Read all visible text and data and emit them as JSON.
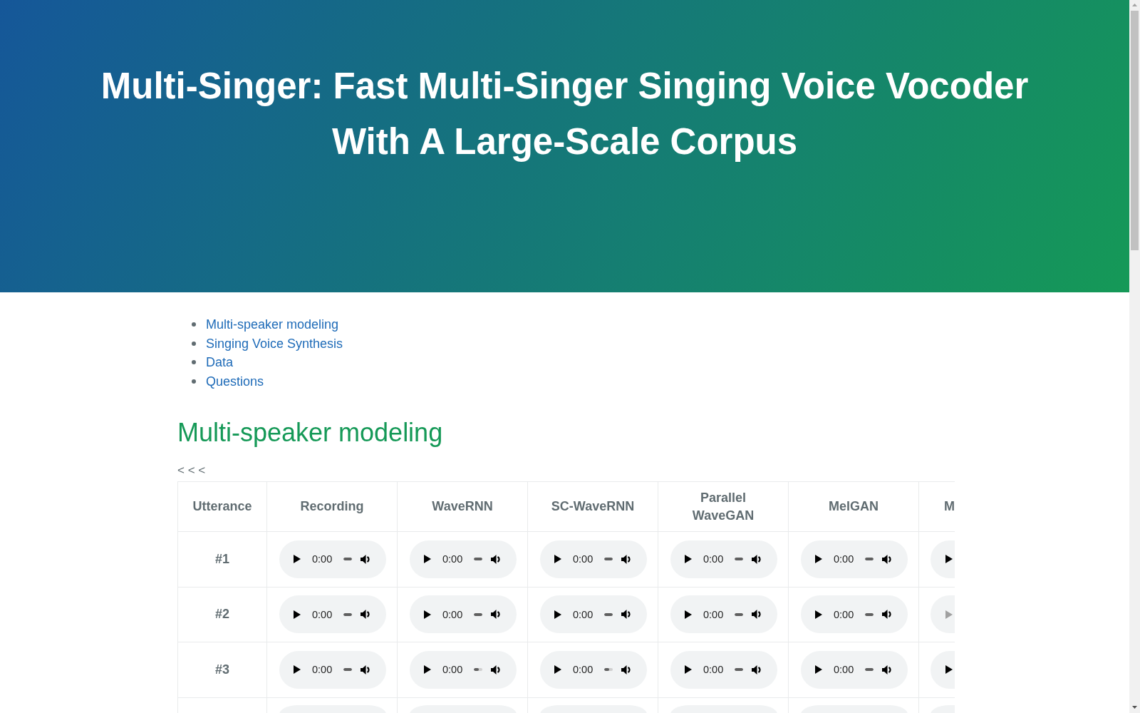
{
  "header": {
    "title": "Multi-Singer: Fast Multi-Singer Singing Voice Vocoder With A Large-Scale Corpus"
  },
  "toc": [
    {
      "label": "Multi-speaker modeling"
    },
    {
      "label": "Singing Voice Synthesis"
    },
    {
      "label": "Data"
    },
    {
      "label": "Questions"
    }
  ],
  "sections": [
    {
      "heading": "Multi-speaker modeling",
      "nav": "< < <",
      "table": {
        "columns": [
          {
            "label": "Utterance",
            "kind": "full"
          },
          {
            "label": "Recording",
            "kind": "full"
          },
          {
            "label": "WaveRNN",
            "kind": "full"
          },
          {
            "label": "SC-WaveRNN",
            "kind": "full"
          },
          {
            "label": "Parallel WaveGAN",
            "kind": "full"
          },
          {
            "label": "MelGAN",
            "kind": "full"
          },
          {
            "label": "M",
            "kind": "cut"
          }
        ],
        "rows": [
          {
            "label": "#1",
            "players": [
              {
                "kind": "full",
                "time": "0:00",
                "level": 1,
                "disabled": false
              },
              {
                "kind": "full",
                "time": "0:00",
                "level": 1,
                "disabled": false
              },
              {
                "kind": "full",
                "time": "0:00",
                "level": 1,
                "disabled": false
              },
              {
                "kind": "full",
                "time": "0:00",
                "level": 1,
                "disabled": false
              },
              {
                "kind": "full",
                "time": "0:00",
                "level": 1,
                "disabled": false
              },
              {
                "kind": "full",
                "disabled": false
              }
            ]
          },
          {
            "label": "#2",
            "players": [
              {
                "kind": "full",
                "time": "0:00",
                "level": 1,
                "disabled": false
              },
              {
                "kind": "full",
                "time": "0:00",
                "level": 1,
                "disabled": false
              },
              {
                "kind": "full",
                "time": "0:00",
                "level": 1,
                "disabled": false
              },
              {
                "kind": "full",
                "time": "0:00",
                "level": 1,
                "disabled": false
              },
              {
                "kind": "full",
                "time": "0:00",
                "level": 1,
                "disabled": false
              },
              {
                "kind": "full",
                "disabled": true
              }
            ]
          },
          {
            "label": "#3",
            "players": [
              {
                "kind": "full",
                "time": "0:00",
                "level": 1,
                "disabled": false
              },
              {
                "kind": "full",
                "time": "0:00",
                "level": 0.6,
                "disabled": false
              },
              {
                "kind": "full",
                "time": "0:00",
                "level": 0.6,
                "disabled": false
              },
              {
                "kind": "full",
                "time": "0:00",
                "level": 1,
                "disabled": false
              },
              {
                "kind": "full",
                "time": "0:00",
                "level": 1,
                "disabled": false
              },
              {
                "kind": "full",
                "disabled": false
              }
            ]
          },
          {
            "players": [
              {
                "kind": "top"
              },
              {
                "kind": "top"
              },
              {
                "kind": "top"
              },
              {
                "kind": "top"
              },
              {
                "kind": "top"
              },
              {
                "kind": "top"
              }
            ]
          }
        ]
      }
    }
  ]
}
